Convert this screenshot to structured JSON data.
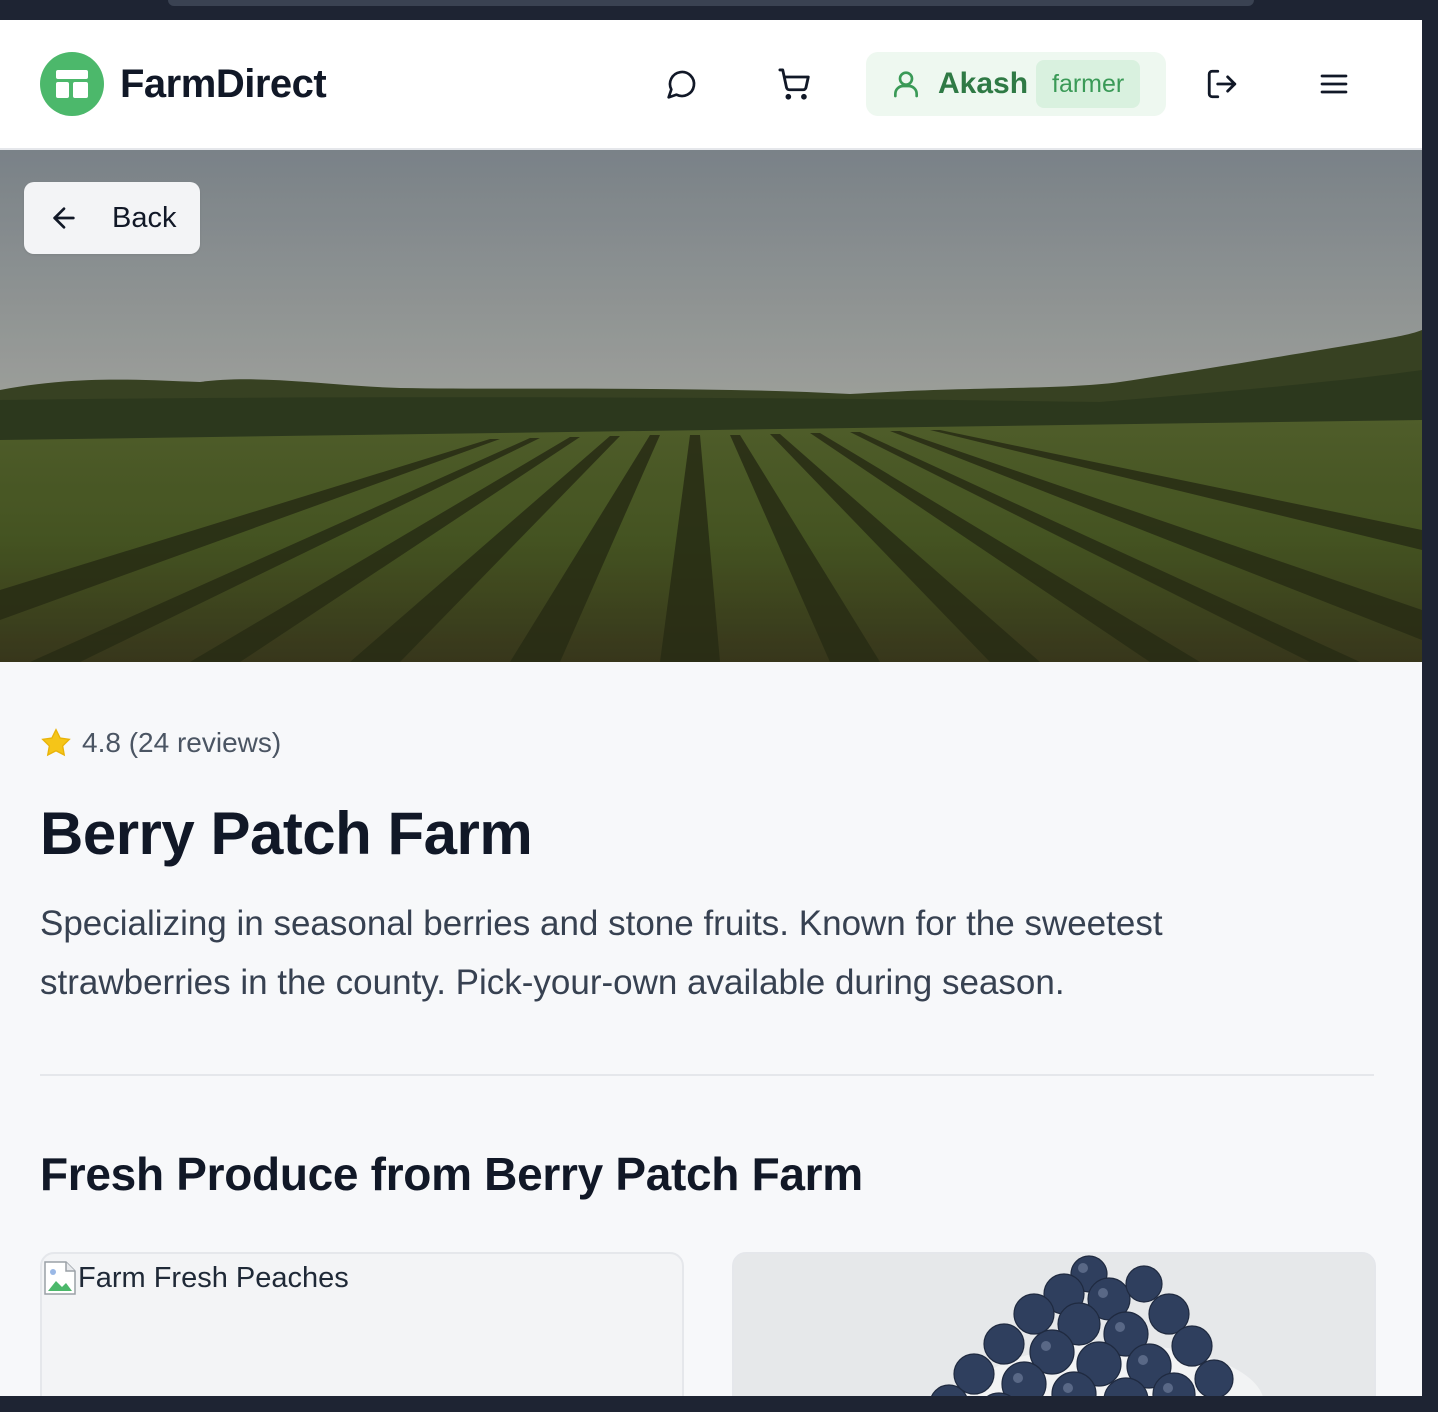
{
  "brand": {
    "name": "FarmDirect",
    "accent": "#4cb86b"
  },
  "header": {
    "icons": [
      "chat-icon",
      "cart-icon",
      "logout-icon",
      "menu-icon"
    ],
    "user": {
      "name": "Akash",
      "role": "farmer"
    }
  },
  "hero": {
    "back_label": "Back",
    "image": "farm-field-rows"
  },
  "farm": {
    "rating_text": "4.8 (24 reviews)",
    "name": "Berry Patch Farm",
    "description": "Specializing in seasonal berries and stone fruits. Known for the sweetest strawberries in the county. Pick-your-own available during season."
  },
  "produce": {
    "heading": "Fresh Produce from Berry Patch Farm",
    "cards": [
      {
        "alt_text": "Farm Fresh Peaches",
        "image": "broken-image"
      },
      {
        "image": "blueberries"
      }
    ]
  }
}
